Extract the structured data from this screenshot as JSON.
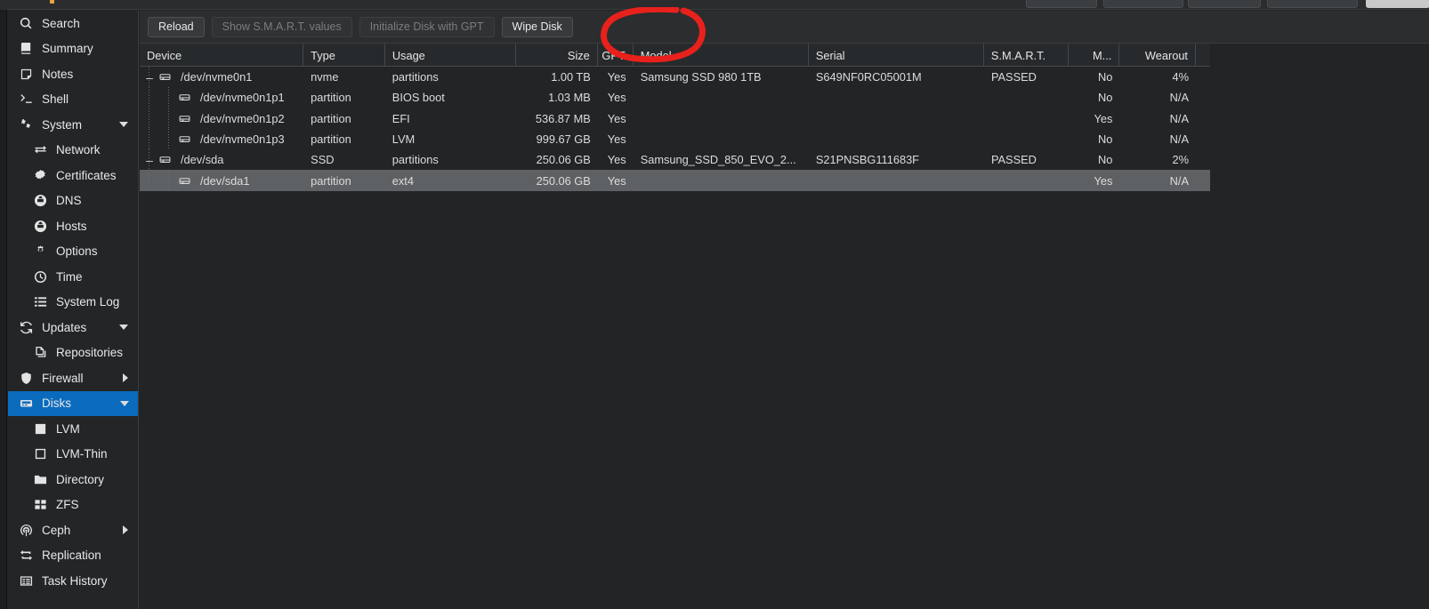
{
  "sidebar": {
    "items": [
      {
        "label": "Search",
        "icon": "search-icon",
        "level": 0,
        "state": "none"
      },
      {
        "label": "Summary",
        "icon": "book-icon",
        "level": 0,
        "state": "none"
      },
      {
        "label": "Notes",
        "icon": "note-icon",
        "level": 0,
        "state": "none"
      },
      {
        "label": "Shell",
        "icon": "terminal-icon",
        "level": 0,
        "state": "none"
      },
      {
        "label": "System",
        "icon": "gears-icon",
        "level": 0,
        "state": "expanded"
      },
      {
        "label": "Network",
        "icon": "exchange-icon",
        "level": 1,
        "state": "none"
      },
      {
        "label": "Certificates",
        "icon": "certificate-icon",
        "level": 1,
        "state": "none"
      },
      {
        "label": "DNS",
        "icon": "globe-icon",
        "level": 1,
        "state": "none"
      },
      {
        "label": "Hosts",
        "icon": "globe-icon",
        "level": 1,
        "state": "none"
      },
      {
        "label": "Options",
        "icon": "gear-icon",
        "level": 1,
        "state": "none"
      },
      {
        "label": "Time",
        "icon": "clock-icon",
        "level": 1,
        "state": "none"
      },
      {
        "label": "System Log",
        "icon": "list-icon",
        "level": 1,
        "state": "none"
      },
      {
        "label": "Updates",
        "icon": "refresh-icon",
        "level": 0,
        "state": "expanded"
      },
      {
        "label": "Repositories",
        "icon": "copy-icon",
        "level": 1,
        "state": "none"
      },
      {
        "label": "Firewall",
        "icon": "shield-icon",
        "level": 0,
        "state": "collapsed"
      },
      {
        "label": "Disks",
        "icon": "disk-icon",
        "level": 0,
        "state": "expanded",
        "selected": true
      },
      {
        "label": "LVM",
        "icon": "square-filled-icon",
        "level": 1,
        "state": "none"
      },
      {
        "label": "LVM-Thin",
        "icon": "square-outline-icon",
        "level": 1,
        "state": "none"
      },
      {
        "label": "Directory",
        "icon": "folder-icon",
        "level": 1,
        "state": "none"
      },
      {
        "label": "ZFS",
        "icon": "grid-icon",
        "level": 1,
        "state": "none"
      },
      {
        "label": "Ceph",
        "icon": "ceph-icon",
        "level": 0,
        "state": "collapsed"
      },
      {
        "label": "Replication",
        "icon": "replication-icon",
        "level": 0,
        "state": "none"
      },
      {
        "label": "Task History",
        "icon": "tasks-icon",
        "level": 0,
        "state": "none"
      }
    ],
    "accent_color": "#0a6bbd"
  },
  "toolbar": {
    "buttons": [
      {
        "label": "Reload",
        "disabled": false
      },
      {
        "label": "Show S.M.A.R.T. values",
        "disabled": true
      },
      {
        "label": "Initialize Disk with GPT",
        "disabled": true
      },
      {
        "label": "Wipe Disk",
        "disabled": false
      }
    ]
  },
  "annotation": {
    "shape": "ellipse",
    "color": "#e8211c",
    "targets": "Wipe Disk"
  },
  "table": {
    "columns": [
      {
        "key": "device",
        "label": "Device",
        "align": "left"
      },
      {
        "key": "type",
        "label": "Type",
        "align": "left"
      },
      {
        "key": "usage",
        "label": "Usage",
        "align": "left"
      },
      {
        "key": "size",
        "label": "Size",
        "align": "right"
      },
      {
        "key": "gpt",
        "label": "GPT",
        "align": "right"
      },
      {
        "key": "model",
        "label": "Model",
        "align": "left"
      },
      {
        "key": "serial",
        "label": "Serial",
        "align": "left"
      },
      {
        "key": "smart",
        "label": "S.M.A.R.T.",
        "align": "left"
      },
      {
        "key": "moved",
        "label": "M...",
        "align": "right"
      },
      {
        "key": "wearout",
        "label": "Wearout",
        "align": "right"
      }
    ],
    "rows": [
      {
        "device": "/dev/nvme0n1",
        "depth": 0,
        "expanded": true,
        "selected": false,
        "type": "nvme",
        "usage": "partitions",
        "size": "1.00 TB",
        "gpt": "Yes",
        "model": "Samsung SSD 980 1TB",
        "serial": "S649NF0RC05001M",
        "smart": "PASSED",
        "moved": "No",
        "wearout": "4%"
      },
      {
        "device": "/dev/nvme0n1p1",
        "depth": 1,
        "expanded": false,
        "selected": false,
        "type": "partition",
        "usage": "BIOS boot",
        "size": "1.03 MB",
        "gpt": "Yes",
        "model": "",
        "serial": "",
        "smart": "",
        "moved": "No",
        "wearout": "N/A"
      },
      {
        "device": "/dev/nvme0n1p2",
        "depth": 1,
        "expanded": false,
        "selected": false,
        "type": "partition",
        "usage": "EFI",
        "size": "536.87 MB",
        "gpt": "Yes",
        "model": "",
        "serial": "",
        "smart": "",
        "moved": "Yes",
        "wearout": "N/A"
      },
      {
        "device": "/dev/nvme0n1p3",
        "depth": 1,
        "expanded": false,
        "selected": false,
        "type": "partition",
        "usage": "LVM",
        "size": "999.67 GB",
        "gpt": "Yes",
        "model": "",
        "serial": "",
        "smart": "",
        "moved": "No",
        "wearout": "N/A"
      },
      {
        "device": "/dev/sda",
        "depth": 0,
        "expanded": true,
        "selected": false,
        "type": "SSD",
        "usage": "partitions",
        "size": "250.06 GB",
        "gpt": "Yes",
        "model": "Samsung_SSD_850_EVO_2...",
        "serial": "S21PNSBG111683F",
        "smart": "PASSED",
        "moved": "No",
        "wearout": "2%"
      },
      {
        "device": "/dev/sda1",
        "depth": 1,
        "expanded": false,
        "selected": true,
        "type": "partition",
        "usage": "ext4",
        "size": "250.06 GB",
        "gpt": "Yes",
        "model": "",
        "serial": "",
        "smart": "",
        "moved": "Yes",
        "wearout": "N/A"
      }
    ]
  }
}
